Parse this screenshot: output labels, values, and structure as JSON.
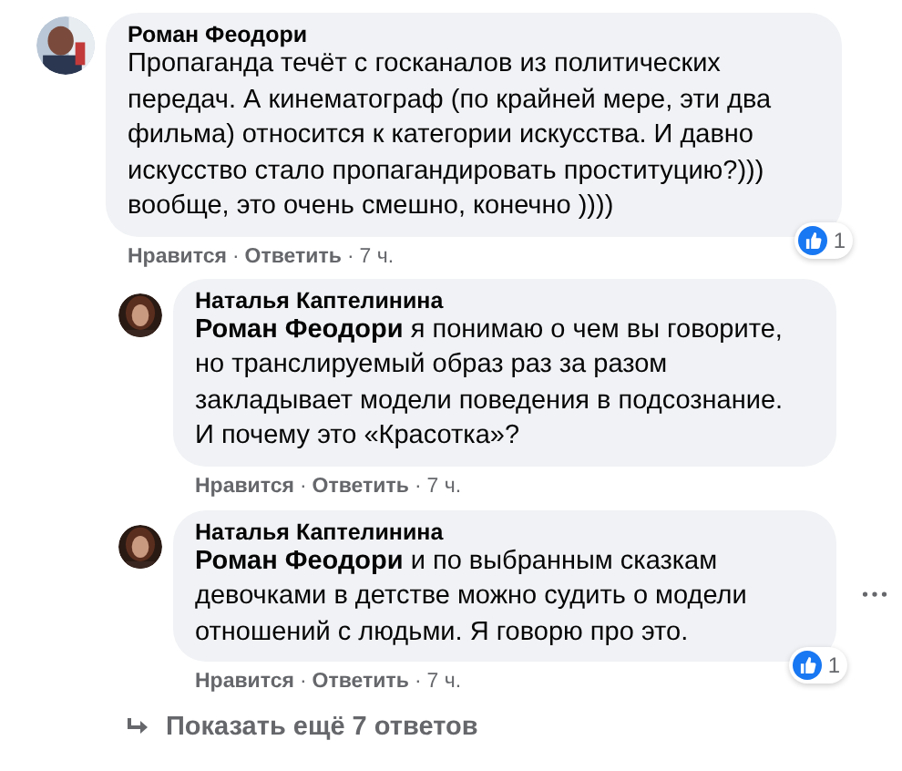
{
  "comments": [
    {
      "author": "Роман Феодори",
      "text": "Пропаганда течёт с госканалов из политических\nпередач. А кинематограф (по крайней мере, эти два\nфильма) относится к категории искусства. И давно\nискусство стало пропагандировать проституцию?)))\nвообще, это очень смешно, конечно ))))",
      "like": "Нравится",
      "reply": "Ответить",
      "time": "7 ч.",
      "sep": "·",
      "reactions": "1",
      "children": [
        {
          "author": "Наталья Каптелинина",
          "text": "**Роман Феодори** я понимаю о чем вы говорите,\nно транслируемый образ раз за разом\nзакладывает модели поведения в подсознание.\nИ почему это «Красотка»?",
          "like": "Нравится",
          "reply": "Ответить",
          "time": "7 ч.",
          "sep": "·",
          "more": false
        },
        {
          "author": "Наталья Каптелинина",
          "text": "**Роман Феодори** и по выбранным сказкам\nдевочками в детстве можно судить о модели\nотношений с людьми. Я говорю про это.",
          "like": "Нравится",
          "reply": "Ответить",
          "time": "7 ч.",
          "sep": "·",
          "reactions": "1",
          "more": true
        }
      ]
    }
  ],
  "show_more": "Показать ещё 7 ответов"
}
